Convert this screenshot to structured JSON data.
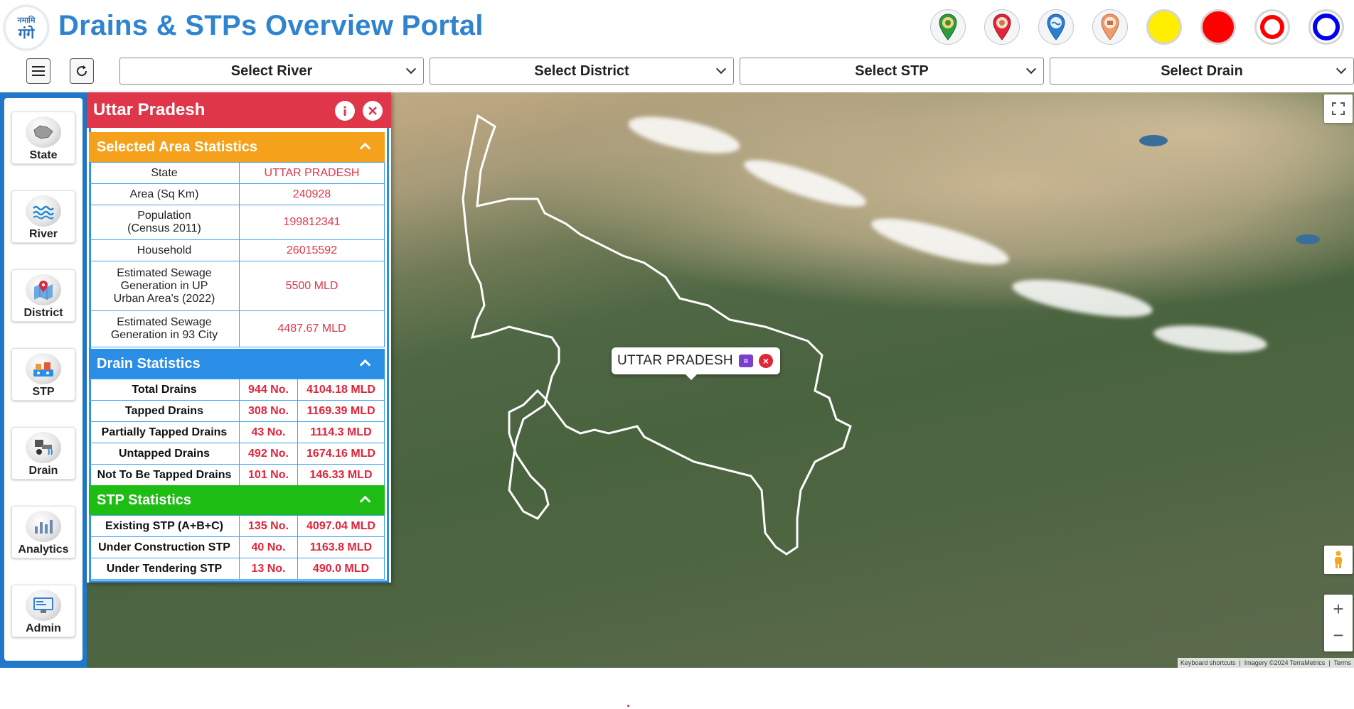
{
  "header": {
    "logo_text_line1": "नमामि",
    "logo_text_line2": "गंगे",
    "title": "Drains & STPs Overview Portal",
    "legend_icons": [
      "state-pin-icon",
      "district-pin-icon",
      "river-pin-icon",
      "stp-pin-icon",
      "yellow-circle-icon",
      "red-circle-icon",
      "red-ring-icon",
      "blue-ring-icon"
    ],
    "colors": {
      "title": "#2f84d0",
      "yellow": "#ffee00",
      "red": "#ff0000",
      "blue": "#0000ee"
    }
  },
  "toolbar": {
    "menu_icon": "hamburger-menu-icon",
    "refresh_icon": "refresh-icon",
    "select_river": "Select River",
    "select_district": "Select District",
    "select_stp": "Select STP",
    "select_drain": "Select Drain"
  },
  "sidebar": {
    "accent": "#1f78c8",
    "items": [
      {
        "label": "State",
        "icon": "state-map-icon"
      },
      {
        "label": "River",
        "icon": "river-waves-icon"
      },
      {
        "label": "District",
        "icon": "district-map-icon"
      },
      {
        "label": "STP",
        "icon": "stp-plant-icon"
      },
      {
        "label": "Drain",
        "icon": "drain-pipe-icon"
      },
      {
        "label": "Analytics",
        "icon": "analytics-chart-icon"
      },
      {
        "label": "Admin",
        "icon": "admin-screen-icon"
      }
    ]
  },
  "panel": {
    "title": "Uttar Pradesh",
    "header_color": "#e0364a",
    "area_section": {
      "title": "Selected Area Statistics",
      "color": "#f5a11b",
      "rows": [
        {
          "key": "State",
          "value": "UTTAR PRADESH"
        },
        {
          "key": "Area (Sq Km)",
          "value": "240928"
        },
        {
          "key_line1": "Population",
          "key_line2": "(Census 2011)",
          "value": "199812341"
        },
        {
          "key": "Household",
          "value": "26015592"
        },
        {
          "key_line1": "Estimated Sewage",
          "key_line2": "Generation in UP",
          "key_line3": "Urban Area's (2022)",
          "value": "5500 MLD"
        },
        {
          "key_line1": "Estimated Sewage",
          "key_line2": "Generation in 93 City",
          "value": "4487.67 MLD"
        }
      ]
    },
    "drain_section": {
      "title": "Drain Statistics",
      "color": "#2a8ee6",
      "rows": [
        {
          "key": "Total Drains",
          "count": "944 No.",
          "flow": "4104.18 MLD"
        },
        {
          "key": "Tapped Drains",
          "count": "308 No.",
          "flow": "1169.39 MLD"
        },
        {
          "key": "Partially Tapped Drains",
          "count": "43 No.",
          "flow": "1114.3 MLD"
        },
        {
          "key": "Untapped Drains",
          "count": "492 No.",
          "flow": "1674.16 MLD"
        },
        {
          "key": "Not To Be Tapped Drains",
          "count": "101 No.",
          "flow": "146.33 MLD"
        }
      ]
    },
    "stp_section": {
      "title": "STP Statistics",
      "color": "#1ebd14",
      "rows": [
        {
          "key": "Existing STP (A+B+C)",
          "count": "135 No.",
          "flow": "4097.04 MLD"
        },
        {
          "key": "Under Construction STP",
          "count": "40 No.",
          "flow": "1163.8 MLD"
        },
        {
          "key": "Under Tendering STP",
          "count": "13 No.",
          "flow": "490.0 MLD"
        }
      ]
    }
  },
  "map": {
    "tooltip_label": "UTTAR PRADESH",
    "attribution_shortcuts": "Keyboard shortcuts",
    "attribution_imagery": "Imagery ©2024 TerraMetrics",
    "attribution_terms": "Terms",
    "zoom_in": "+",
    "zoom_out": "−"
  }
}
